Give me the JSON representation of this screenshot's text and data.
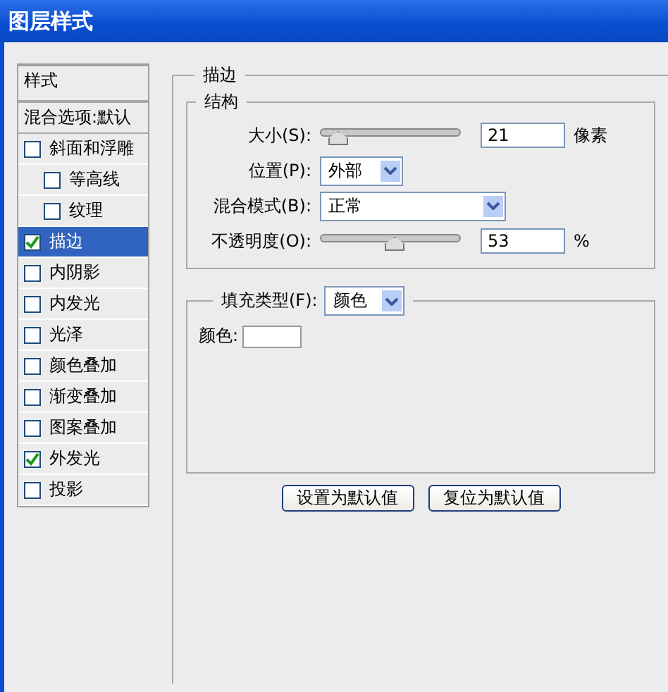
{
  "window": {
    "title": "图层样式"
  },
  "sidebar": {
    "header": "样式",
    "blend_options": "混合选项:默认",
    "items": [
      {
        "label": "斜面和浮雕",
        "checked": false,
        "selected": false,
        "children": [
          {
            "label": "等高线",
            "checked": false,
            "selected": false
          },
          {
            "label": "纹理",
            "checked": false,
            "selected": false
          }
        ]
      },
      {
        "label": "描边",
        "checked": true,
        "selected": true
      },
      {
        "label": "内阴影",
        "checked": false,
        "selected": false
      },
      {
        "label": "内发光",
        "checked": false,
        "selected": false
      },
      {
        "label": "光泽",
        "checked": false,
        "selected": false
      },
      {
        "label": "颜色叠加",
        "checked": false,
        "selected": false
      },
      {
        "label": "渐变叠加",
        "checked": false,
        "selected": false
      },
      {
        "label": "图案叠加",
        "checked": false,
        "selected": false
      },
      {
        "label": "外发光",
        "checked": true,
        "selected": false
      },
      {
        "label": "投影",
        "checked": false,
        "selected": false
      }
    ]
  },
  "panel": {
    "title": "描边",
    "structure": {
      "title": "结构",
      "rows": [
        {
          "kind": "slider",
          "label": "大小(S):",
          "level": 0.13,
          "value": "21",
          "unit": "像素"
        },
        {
          "kind": "select",
          "label": "位置(P):",
          "value": "外部",
          "wide": false
        },
        {
          "kind": "select",
          "label": "混合模式(B):",
          "value": "正常",
          "wide": true
        },
        {
          "kind": "slider",
          "label": "不透明度(O):",
          "level": 0.53,
          "value": "53",
          "unit": "%"
        }
      ]
    },
    "fill": {
      "label": "填充类型(F):",
      "value": "颜色",
      "color_label": "颜色:",
      "color": "#ffffff"
    }
  },
  "buttons": [
    "设置为默认值",
    "复位为默认值"
  ]
}
